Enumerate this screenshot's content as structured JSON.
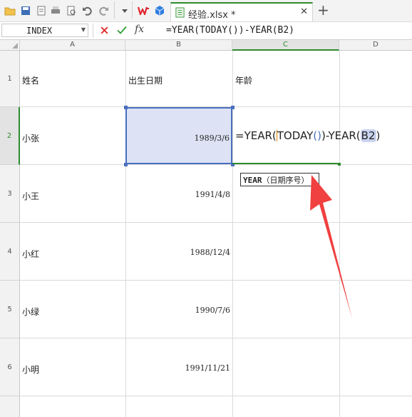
{
  "window": {
    "file_tab": "经验.xlsx *"
  },
  "formula_bar": {
    "name_box": "INDEX",
    "fx_label": "fx",
    "formula": "=YEAR(TODAY())-YEAR(B2)"
  },
  "columns": [
    "A",
    "B",
    "C",
    "D"
  ],
  "rows": [
    "1",
    "2",
    "3",
    "4",
    "5",
    "6"
  ],
  "cells": {
    "A1": "姓名",
    "B1": "出生日期",
    "C1": "年龄",
    "A2": "小张",
    "B2": "1989/3/6",
    "A3": "小王",
    "B3": "1991/4/8",
    "A4": "小红",
    "B4": "1988/12/4",
    "A5": "小绿",
    "B5": "1990/7/6",
    "A6": "小明",
    "B6": "1991/11/21"
  },
  "edit_cell": {
    "part1": "=YEAR(",
    "part2": "TODAY",
    "part3": "(",
    "part4": ")",
    "part5": ")-YEAR(",
    "ref": "B2",
    "part6": ")"
  },
  "tooltip": {
    "func": "YEAR",
    "args": "（日期序号）"
  },
  "colors": {
    "accent_green": "#2e8b2e",
    "selection_blue": "#4a6fc0",
    "wps_red": "#e0252d",
    "arrow_red": "#f04040"
  }
}
